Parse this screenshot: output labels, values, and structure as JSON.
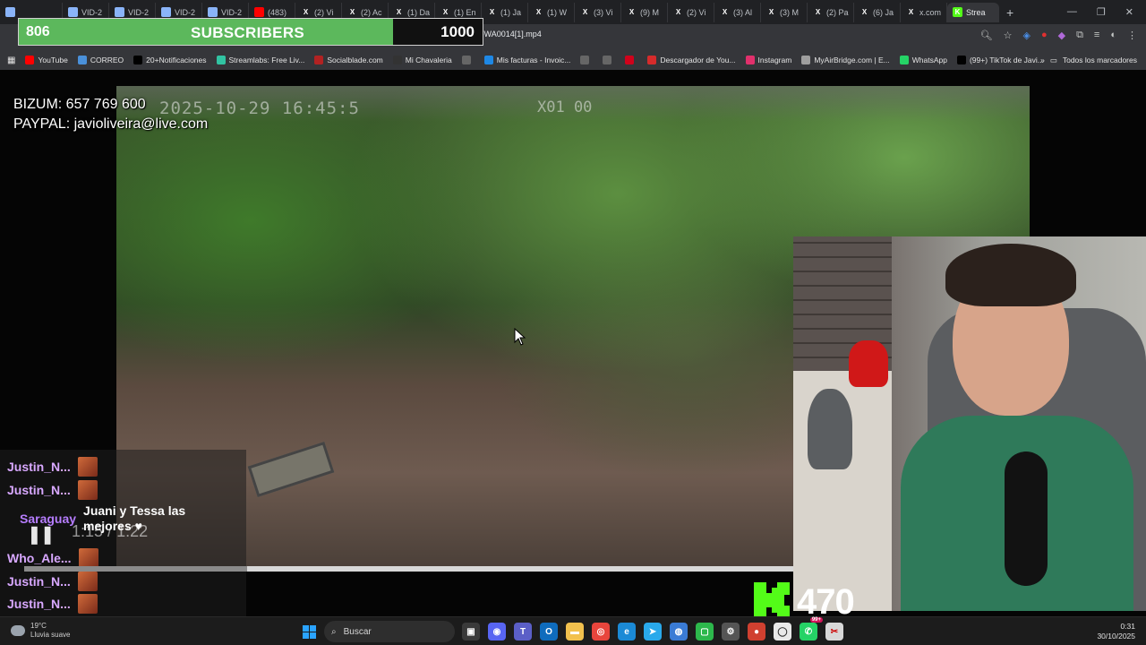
{
  "browser": {
    "tabs": [
      {
        "label": "",
        "icon": "chrome-icon",
        "color": "#8ab4f8"
      },
      {
        "label": "VID-2",
        "icon": "chrome-icon",
        "color": "#8ab4f8"
      },
      {
        "label": "VID-2",
        "icon": "chrome-icon",
        "color": "#8ab4f8"
      },
      {
        "label": "VID-2",
        "icon": "chrome-icon",
        "color": "#8ab4f8"
      },
      {
        "label": "VID-2",
        "icon": "chrome-icon",
        "color": "#8ab4f8"
      },
      {
        "label": "(483)",
        "icon": "youtube-icon",
        "color": "#ff0000"
      },
      {
        "label": "(2) Vi",
        "icon": "x-icon",
        "color": "#000000"
      },
      {
        "label": "(2) Ac",
        "icon": "x-icon",
        "color": "#000000"
      },
      {
        "label": "(1) Da",
        "icon": "x-icon",
        "color": "#000000"
      },
      {
        "label": "(1) En",
        "icon": "x-icon",
        "color": "#000000"
      },
      {
        "label": "(1) Ja",
        "icon": "x-icon",
        "color": "#000000"
      },
      {
        "label": "(1) W",
        "icon": "x-icon",
        "color": "#000000"
      },
      {
        "label": "(3) Vi",
        "icon": "x-icon",
        "color": "#000000"
      },
      {
        "label": "(9) M",
        "icon": "x-icon",
        "color": "#000000"
      },
      {
        "label": "(2) Vi",
        "icon": "x-icon",
        "color": "#000000"
      },
      {
        "label": "(3) Al",
        "icon": "x-icon",
        "color": "#000000"
      },
      {
        "label": "(3) M",
        "icon": "x-icon",
        "color": "#000000"
      },
      {
        "label": "(2) Pa",
        "icon": "x-icon",
        "color": "#000000"
      },
      {
        "label": "(6) Ja",
        "icon": "x-icon",
        "color": "#000000"
      },
      {
        "label": "x.com",
        "icon": "x-icon",
        "color": "#000000"
      },
      {
        "label": "Strea",
        "icon": "kick-icon",
        "color": "#53fc18"
      }
    ],
    "new_tab": "+",
    "url": "KOKMGW8/VID-20251029-WA0014[1].mp4",
    "bookmarks": [
      {
        "label": "YouTube",
        "icon": "youtube-icon",
        "color": "#ff0000"
      },
      {
        "label": "CORREO",
        "icon": "mail-icon",
        "color": "#4a90d9"
      },
      {
        "label": "20+Notificaciones",
        "icon": "x-icon",
        "color": "#000000"
      },
      {
        "label": "Streamlabs: Free Liv...",
        "icon": "streamlabs-icon",
        "color": "#31c3a2"
      },
      {
        "label": "Socialblade.com",
        "icon": "socialblade-icon",
        "color": "#b22222"
      },
      {
        "label": "Mi Chavaleria",
        "icon": "github-icon",
        "color": "#333333"
      },
      {
        "label": "",
        "icon": "globe-icon",
        "color": "#666666"
      },
      {
        "label": "Mis facturas - Invoic...",
        "icon": "invoice-icon",
        "color": "#1e88e5"
      },
      {
        "label": "",
        "icon": "globe-icon",
        "color": "#666666"
      },
      {
        "label": "",
        "icon": "globe-icon",
        "color": "#666666"
      },
      {
        "label": "",
        "icon": "apple-icon",
        "color": "#d0021b"
      },
      {
        "label": "Descargador de You...",
        "icon": "download-icon",
        "color": "#d62b2b"
      },
      {
        "label": "Instagram",
        "icon": "instagram-icon",
        "color": "#e1306c"
      },
      {
        "label": "MyAirBridge.com | E...",
        "icon": "cloud-icon",
        "color": "#9e9e9e"
      },
      {
        "label": "WhatsApp",
        "icon": "whatsapp-icon",
        "color": "#25d366"
      },
      {
        "label": "(99+) TikTok de Javi...",
        "icon": "tiktok-icon",
        "color": "#010101"
      }
    ],
    "all_bookmarks": "Todos los marcadores"
  },
  "overlay": {
    "subs_count": "806",
    "subs_label": "SUBSCRIBERS",
    "subs_goal": "1000",
    "subs_progress": 0.806,
    "bizum": "BIZUM: 657 769 600",
    "paypal": "PAYPAL: javioliveira@live.com",
    "kick_viewers": "470"
  },
  "video": {
    "osd_timestamp": "2025-10-29 16:45:5",
    "osd_right": "X01  00",
    "time_current": "1:15",
    "time_total": "1:22",
    "progress": 0.29
  },
  "chat": [
    {
      "user": "Justin_N...",
      "color": "#d8a8ff",
      "message": ""
    },
    {
      "user": "Justin_N...",
      "color": "#d8a8ff",
      "message": ""
    },
    {
      "user": "Saraguay",
      "color": "#b67dff",
      "message": "Juani y Tessa las mejores ♥"
    },
    {
      "user": "Who_Ale...",
      "color": "#d8a8ff",
      "message": ""
    },
    {
      "user": "Justin_N...",
      "color": "#d8a8ff",
      "message": ""
    },
    {
      "user": "Justin_N...",
      "color": "#d8a8ff",
      "message": ""
    }
  ],
  "taskbar": {
    "temperature": "19°C",
    "weather": "Lluvia suave",
    "search_placeholder": "Buscar",
    "time": "0:31",
    "date": "30/10/2025",
    "notification_badge": "99+"
  }
}
